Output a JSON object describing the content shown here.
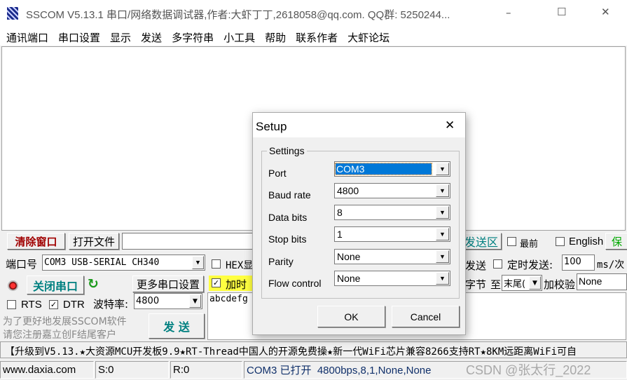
{
  "window": {
    "title": "SSCOM V5.13.1 串口/网络数据调试器,作者:大虾丁丁,2618058@qq.com. QQ群: 5250244...",
    "minimize": "–",
    "maximize": "☐",
    "close": "✕"
  },
  "menu": [
    "通讯端口",
    "串口设置",
    "显示",
    "发送",
    "多字符串",
    "小工具",
    "帮助",
    "联系作者",
    "大虾论坛"
  ],
  "toolbar": {
    "clear_window": "清除窗口",
    "open_file": "打开文件",
    "send_area": "发送区",
    "topmost": "最前",
    "english": "English",
    "save": "保"
  },
  "port": {
    "label": "端口号",
    "value": "COM3 USB-SERIAL CH340",
    "close_port": "关闭串口",
    "more_settings": "更多串口设置",
    "rts": "RTS",
    "dtr": "DTR",
    "rts_checked": false,
    "dtr_checked": true,
    "baud_label": "波特率:",
    "baud_value": "4800"
  },
  "send": {
    "hex_display": "HEX显",
    "add_time": "加时",
    "send_text": "abcdefg",
    "hex_send_label": "发送",
    "timed_send": "定时发送:",
    "interval": "100",
    "interval_unit": "ms/次",
    "bytes_label": "字节",
    "to_label": "至",
    "end_value": "末尾(",
    "checksum_label": "加校验",
    "checksum_value": "None",
    "send_button": "发 送"
  },
  "promo": {
    "line1": "为了更好地发展SSCOM软件",
    "line2": "请您注册嘉立创F结尾客户"
  },
  "ticker": "【升级到V5.13.★大资源MCU开发板9.9★RT-Thread中国人的开源免费操★新一代WiFi芯片兼容8266支持RT★8KM远距离WiFi可自",
  "status": {
    "site": "www.daxia.com",
    "sent": "S:0",
    "received": "R:0",
    "port_status": "COM3 已打开  4800bps,8,1,None,None",
    "watermark": "CSDN @张太行_2022"
  },
  "dialog": {
    "title": "Setup",
    "group": "Settings",
    "fields": [
      {
        "label": "Port",
        "value": "COM3"
      },
      {
        "label": "Baud rate",
        "value": "4800"
      },
      {
        "label": "Data bits",
        "value": "8"
      },
      {
        "label": "Stop bits",
        "value": "1"
      },
      {
        "label": "Parity",
        "value": "None"
      },
      {
        "label": "Flow control",
        "value": "None"
      }
    ],
    "ok": "OK",
    "cancel": "Cancel"
  },
  "colors": {
    "clear_text": "#a00000",
    "accent_green": "#008080",
    "highlight_yellow": "#ffff40",
    "selection_blue": "#0078d7"
  }
}
